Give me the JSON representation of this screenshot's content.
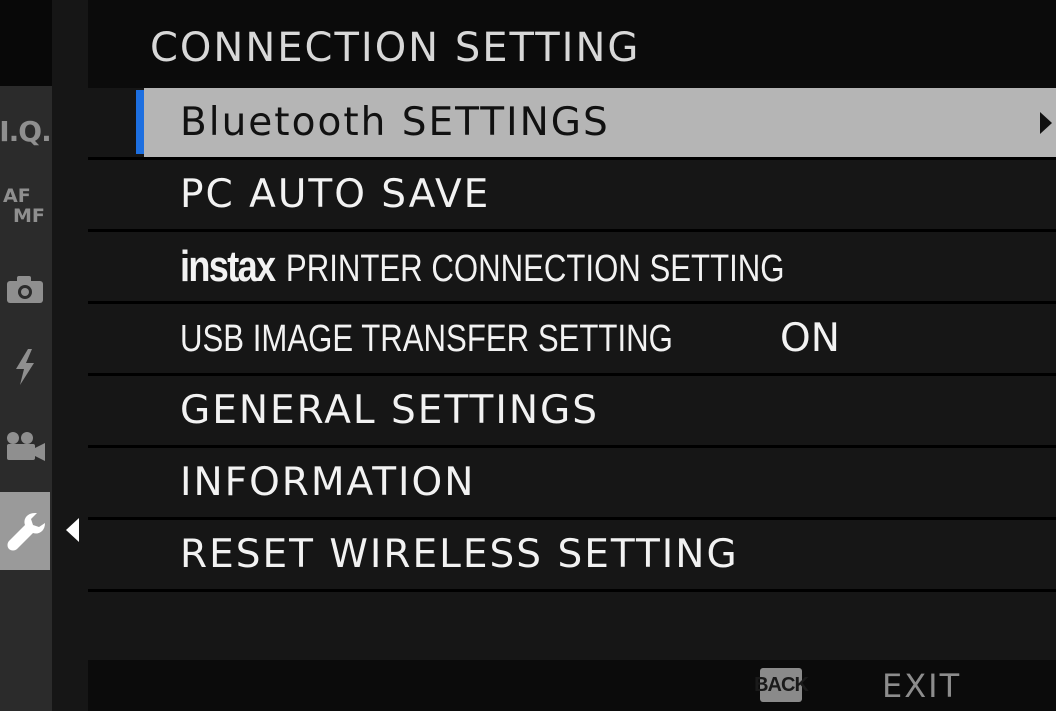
{
  "header": {
    "title": "CONNECTION SETTING"
  },
  "sidebar": {
    "items": [
      {
        "label": "I.Q.",
        "icon": "image-quality-icon"
      },
      {
        "label_top": "AF",
        "label_bottom": "MF",
        "icon": "af-mf-icon"
      },
      {
        "icon": "camera-icon"
      },
      {
        "icon": "flash-icon"
      },
      {
        "icon": "movie-camera-icon"
      },
      {
        "icon": "wrench-icon",
        "active": true
      }
    ]
  },
  "menu": {
    "items": [
      {
        "label": "Bluetooth SETTINGS",
        "selected": true,
        "has_submenu": true
      },
      {
        "label": "PC AUTO SAVE"
      },
      {
        "brand": "instax",
        "label": "PRINTER CONNECTION SETTING"
      },
      {
        "label": "USB IMAGE TRANSFER SETTING",
        "value": "ON"
      },
      {
        "label": "GENERAL SETTINGS"
      },
      {
        "label": "INFORMATION"
      },
      {
        "label": "RESET WIRELESS SETTING"
      }
    ]
  },
  "footer": {
    "back_key": "BACK",
    "exit_label": "EXIT"
  },
  "colors": {
    "selection_accent": "#1d6fe0",
    "selected_row": "#b5b5b5",
    "background": "#0b0b0b"
  }
}
